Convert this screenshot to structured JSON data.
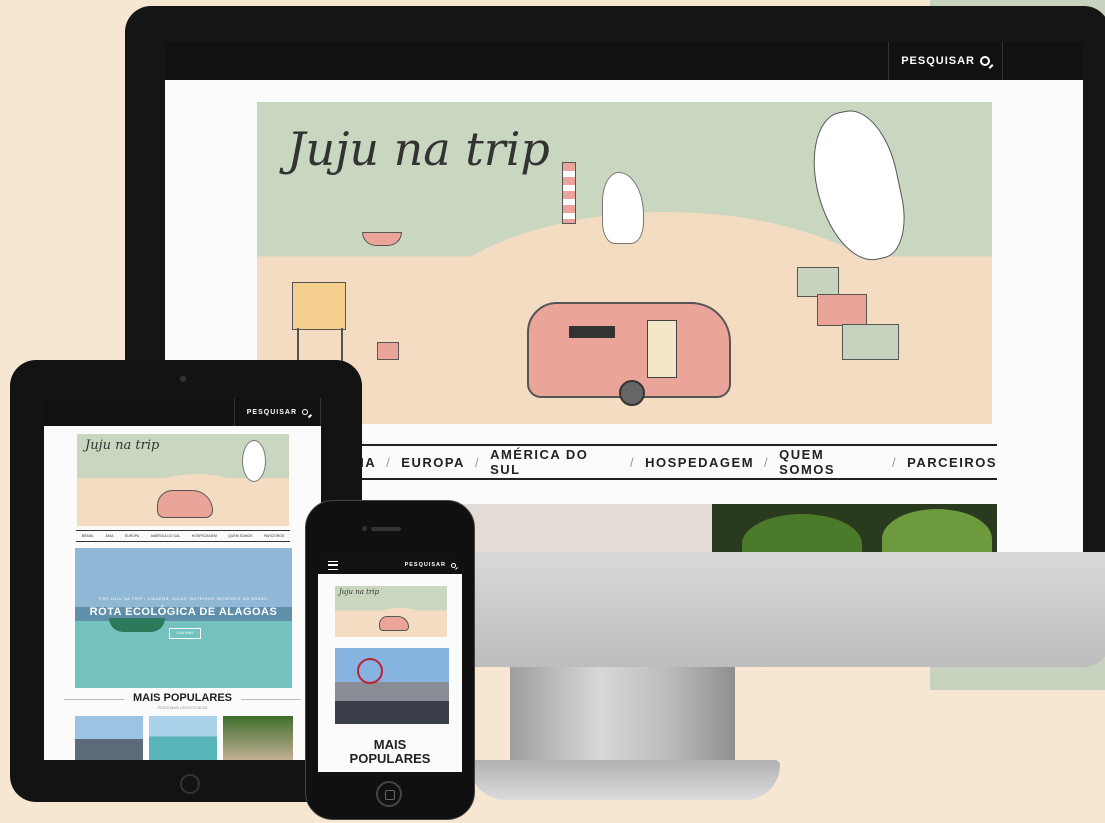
{
  "brand": {
    "title": "Juju na trip"
  },
  "header": {
    "search_label": "PESQUISAR"
  },
  "nav": {
    "items": [
      "SIA",
      "EUROPA",
      "AMÉRICA DO SUL",
      "HOSPEDAGEM",
      "QUEM SOMOS",
      "PARCEIROS"
    ],
    "tablet_items": [
      "BRASIL",
      "ÁSIA",
      "EUROPA",
      "AMÉRICA DO SUL",
      "HOSPEDAGEM",
      "QUEM SOMOS",
      "PARCEIROS"
    ]
  },
  "hero": {
    "kicker": "POR JUJU NA TRIP / VIAGENS, DICAS, ROTEIROS INCRÍVEIS NO BRASIL",
    "headline": "ROTA ECOLÓGICA DE ALAGOAS",
    "button": "LEIA MAIS"
  },
  "popular": {
    "heading": "MAIS POPULARES",
    "phone_heading_line1": "MAIS",
    "phone_heading_line2": "POPULARES",
    "sub": "POSTS MAIS LIDOS DO BLOG"
  },
  "icons": {
    "search": "search-icon",
    "menu": "hamburger-menu-icon"
  },
  "colors": {
    "page_bg": "#f7e7d2",
    "sage": "#c8d3bf",
    "sand": "#f3dcc1",
    "trailer": "#eaa49a",
    "bar": "#111111"
  }
}
